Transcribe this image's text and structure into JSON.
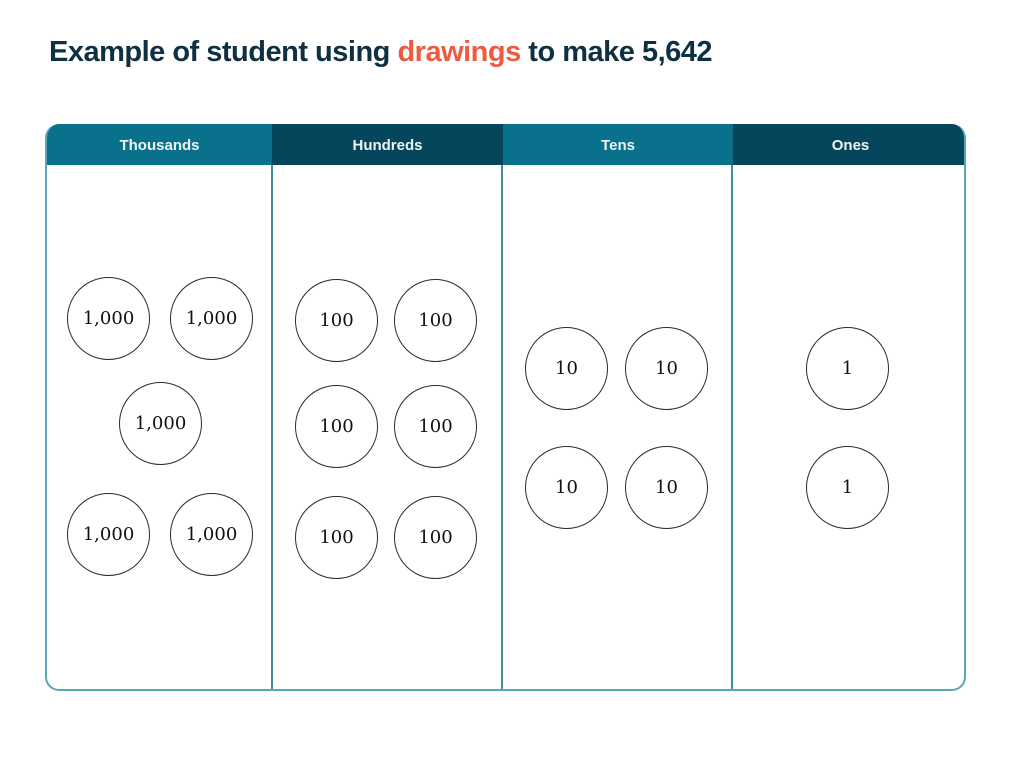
{
  "title": {
    "prefix": "Example of student using ",
    "highlight": "drawings",
    "suffix": " to make 5,642",
    "highlight_color": "#ef5a41",
    "text_color": "#0f3042"
  },
  "columns": [
    {
      "label": "Thousands",
      "header_color": "#09718b",
      "circles": [
        "1,000",
        "1,000",
        "1,000",
        "1,000",
        "1,000"
      ]
    },
    {
      "label": "Hundreds",
      "header_color": "#05465c",
      "circles": [
        "100",
        "100",
        "100",
        "100",
        "100",
        "100"
      ]
    },
    {
      "label": "Tens",
      "header_color": "#09718b",
      "circles": [
        "10",
        "10",
        "10",
        "10"
      ]
    },
    {
      "label": "Ones",
      "header_color": "#05465c",
      "circles": [
        "1",
        "1"
      ]
    }
  ]
}
